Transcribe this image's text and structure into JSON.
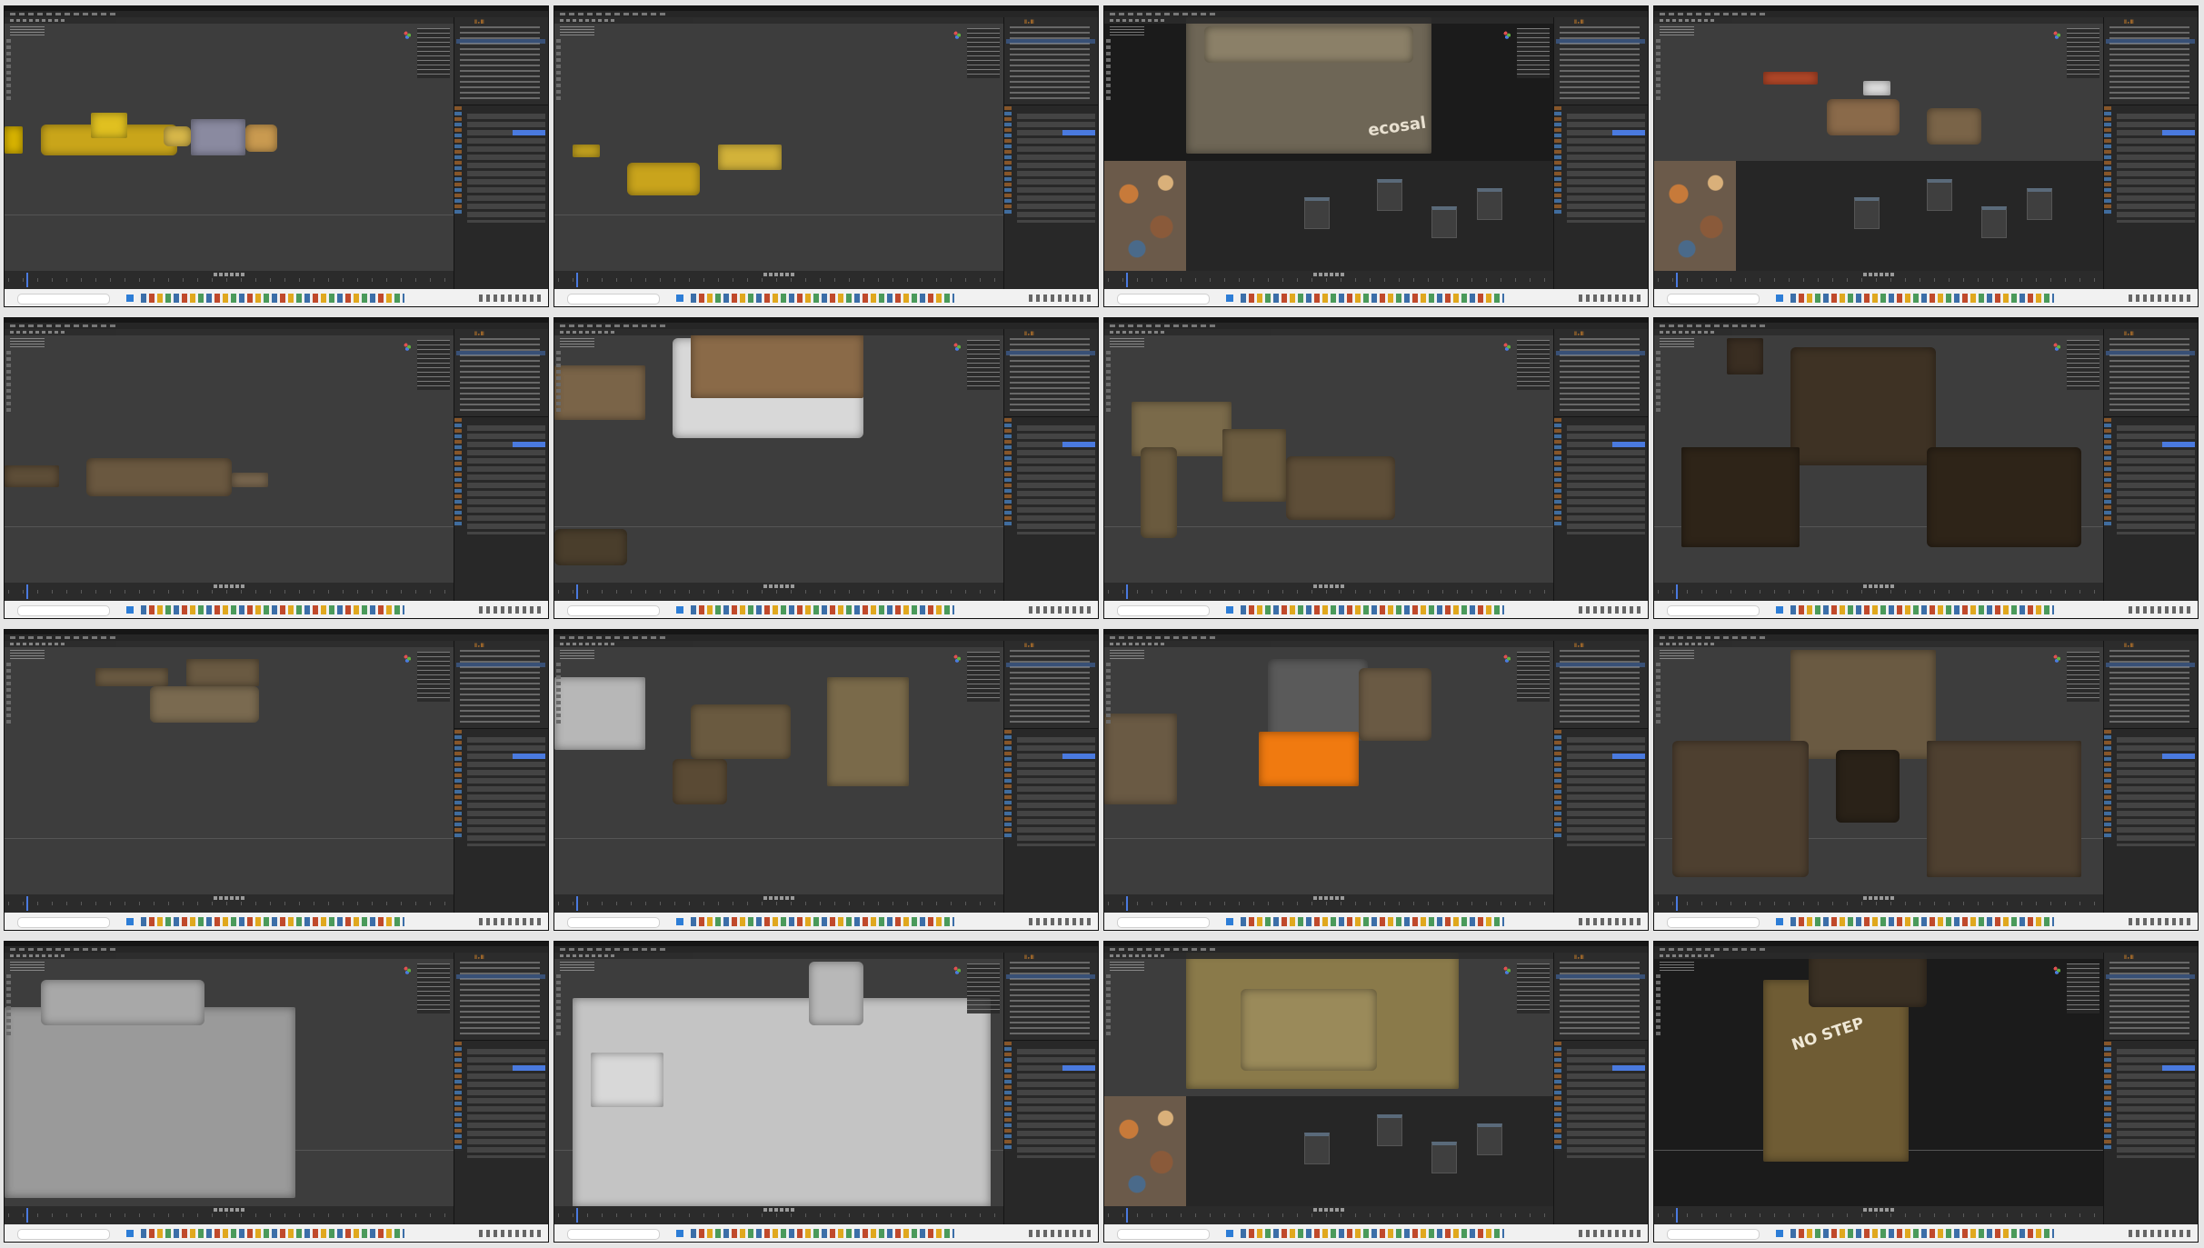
{
  "app": {
    "outliner_tag": "ⅡₑⅢ",
    "window_layout": "3D Viewport + Outliner + Properties + Timeline",
    "accent_color": "#4a7adf",
    "selection_color": "#e08a2a",
    "icons": [
      "cursor-icon",
      "move-icon",
      "gizmo-axis-icon",
      "camera-icon",
      "hand-icon",
      "play-icon",
      "windows-start-icon",
      "search-icon"
    ]
  },
  "tiles": [
    {
      "name": "tile-01",
      "scene": "yellow-mining-machine-parts",
      "has_nodes": false,
      "viewport": "grey"
    },
    {
      "name": "tile-02",
      "scene": "yellow-arm-parts",
      "has_nodes": false,
      "viewport": "grey"
    },
    {
      "name": "tile-03",
      "scene": "textured-hull-closeup",
      "has_nodes": true,
      "viewport": "dark",
      "overlay_text": "ecosal"
    },
    {
      "name": "tile-04",
      "scene": "texture-atlas-parts",
      "has_nodes": true,
      "viewport": "grey"
    },
    {
      "name": "tile-05",
      "scene": "weathered-parts-row",
      "has_nodes": false,
      "viewport": "grey"
    },
    {
      "name": "tile-06",
      "scene": "container-assembly",
      "has_nodes": false,
      "viewport": "grey"
    },
    {
      "name": "tile-07",
      "scene": "walker-side-view",
      "has_nodes": false,
      "viewport": "grey"
    },
    {
      "name": "tile-08",
      "scene": "walker-front-view",
      "has_nodes": false,
      "viewport": "grey"
    },
    {
      "name": "tile-09",
      "scene": "scattered-parts",
      "has_nodes": false,
      "viewport": "grey"
    },
    {
      "name": "tile-10",
      "scene": "walker-legs-assembly",
      "has_nodes": false,
      "viewport": "grey"
    },
    {
      "name": "tile-11",
      "scene": "orange-arm-selected",
      "has_nodes": false,
      "viewport": "grey"
    },
    {
      "name": "tile-12",
      "scene": "walker-front-detailed",
      "has_nodes": false,
      "viewport": "grey"
    },
    {
      "name": "tile-13",
      "scene": "clay-hull-left",
      "has_nodes": false,
      "viewport": "grey"
    },
    {
      "name": "tile-14",
      "scene": "clay-hull-closeup",
      "has_nodes": false,
      "viewport": "grey"
    },
    {
      "name": "tile-15",
      "scene": "textured-leg-closeup",
      "has_nodes": true,
      "viewport": "grey"
    },
    {
      "name": "tile-16",
      "scene": "foot-no-step",
      "has_nodes": false,
      "viewport": "dark",
      "overlay_text": "NO STEP"
    }
  ]
}
